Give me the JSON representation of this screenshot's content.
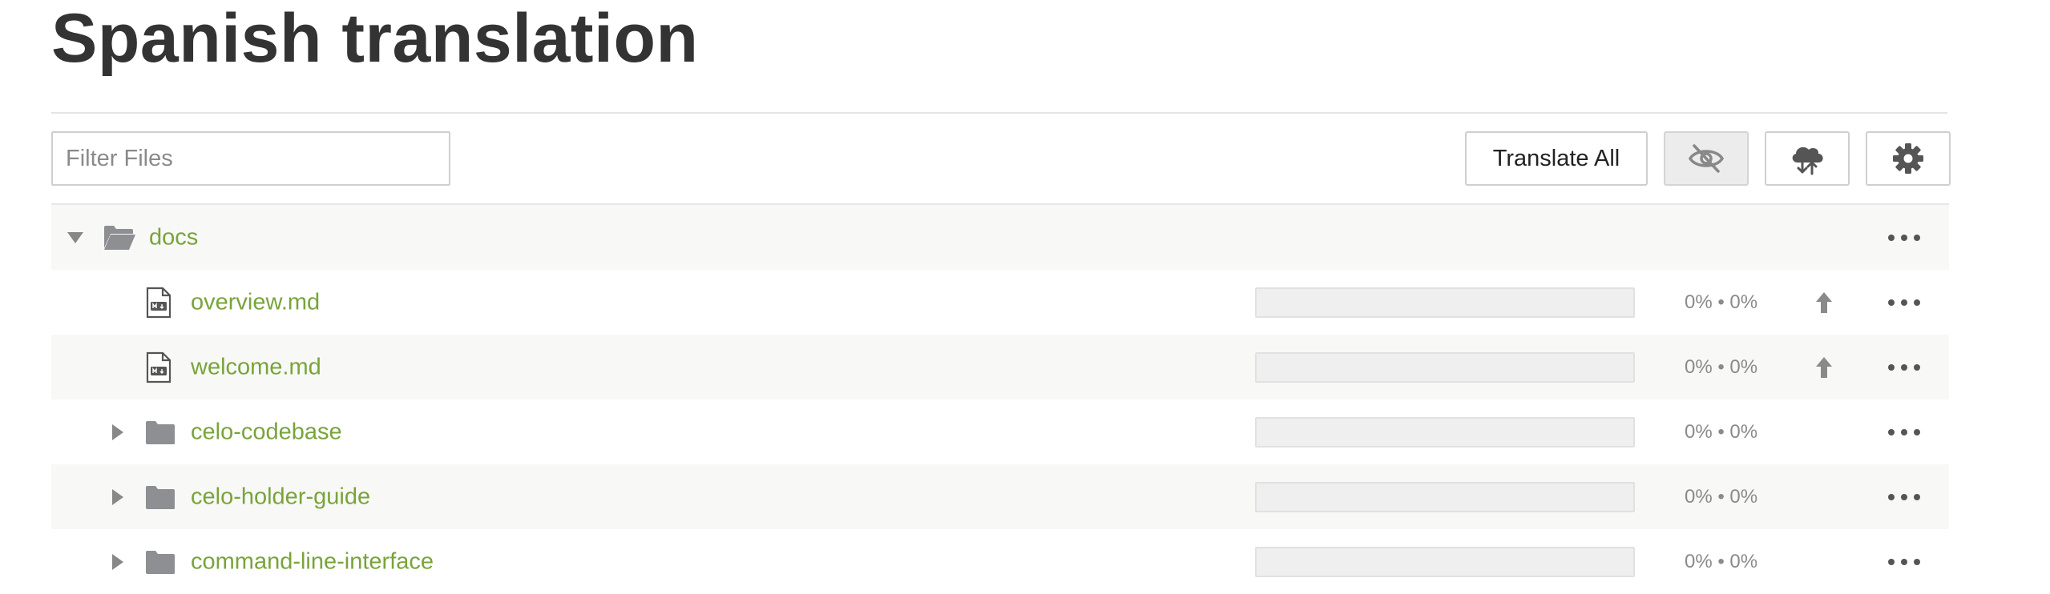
{
  "page": {
    "title": "Spanish translation"
  },
  "toolbar": {
    "filter_placeholder": "Filter Files",
    "filter_value": "",
    "translate_all_label": "Translate All",
    "hide_icon": "eye-slash-icon",
    "cloud_icon": "cloud-sync-icon",
    "settings_icon": "gear-icon"
  },
  "colors": {
    "link": "#78a43a",
    "folder": "#8e8f93",
    "text": "#333333",
    "muted": "#8a8a8a"
  },
  "tree": {
    "root": {
      "name": "docs",
      "expanded": true,
      "icon": "folder-open-icon"
    },
    "items": [
      {
        "name": "overview.md",
        "type": "file",
        "progress_text": "0% • 0%",
        "progress": 0,
        "upload": true
      },
      {
        "name": "welcome.md",
        "type": "file",
        "progress_text": "0% • 0%",
        "progress": 0,
        "upload": true
      },
      {
        "name": "celo-codebase",
        "type": "folder",
        "progress_text": "0% • 0%",
        "progress": 0,
        "upload": false
      },
      {
        "name": "celo-holder-guide",
        "type": "folder",
        "progress_text": "0% • 0%",
        "progress": 0,
        "upload": false
      },
      {
        "name": "command-line-interface",
        "type": "folder",
        "progress_text": "0% • 0%",
        "progress": 0,
        "upload": false
      }
    ]
  }
}
